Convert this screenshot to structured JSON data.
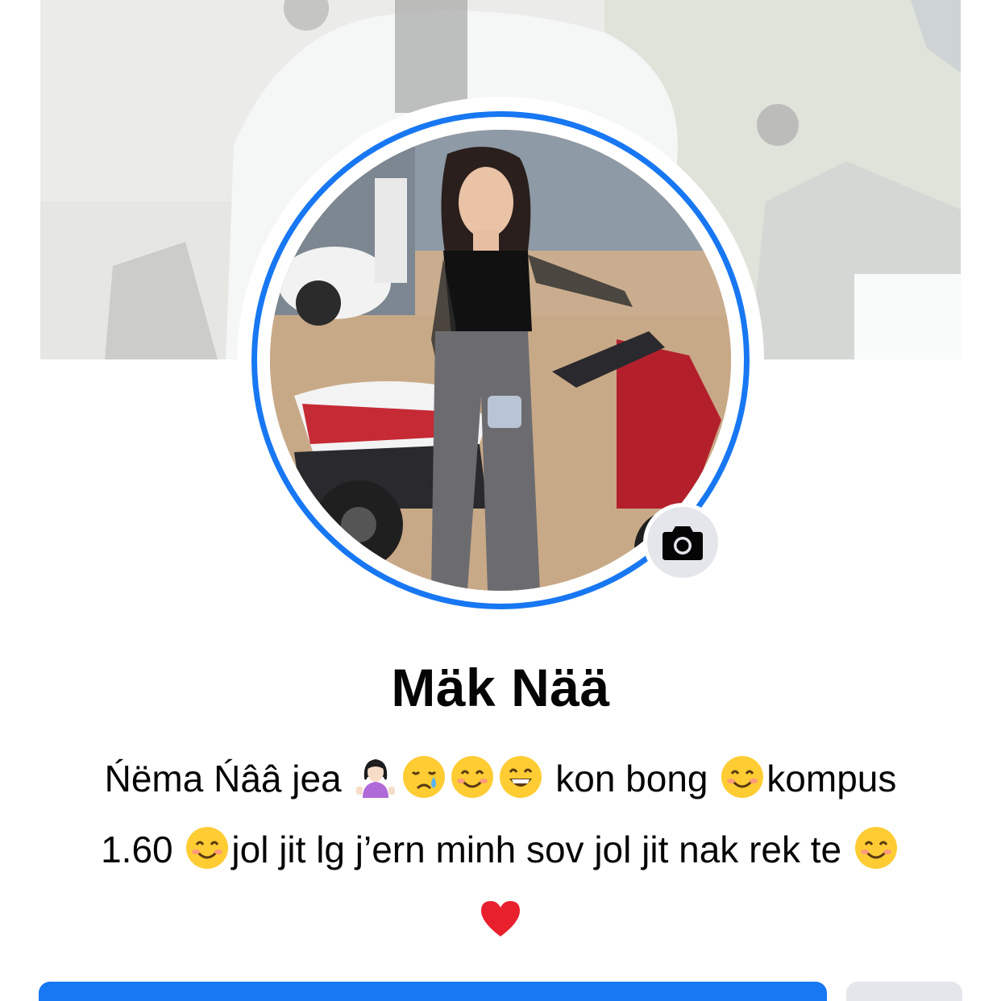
{
  "profile": {
    "name": "Mäk Nää",
    "bio_parts": [
      {
        "type": "text",
        "value": "Ńëma Ńââ jea "
      },
      {
        "type": "emoji",
        "icon": "woman-shrugging-emoji"
      },
      {
        "type": "emoji",
        "icon": "crying-face-emoji"
      },
      {
        "type": "emoji",
        "icon": "smiling-face-emoji"
      },
      {
        "type": "emoji",
        "icon": "grinning-face-emoji"
      },
      {
        "type": "text",
        "value": " kon bong "
      },
      {
        "type": "emoji",
        "icon": "smiling-face-emoji"
      },
      {
        "type": "text",
        "value": "kompus 1.60 "
      },
      {
        "type": "emoji",
        "icon": "smiling-face-emoji"
      },
      {
        "type": "text",
        "value": "jol jit lg j’ern minh sov jol jit nak rek te "
      },
      {
        "type": "emoji",
        "icon": "smiling-face-emoji"
      },
      {
        "type": "emoji",
        "icon": "red-heart-emoji"
      }
    ]
  },
  "bio_text": {
    "t1": "Ńëma Ńââ jea ",
    "t2": " kon bong ",
    "t3": "kompus",
    "t4": "1.60 ",
    "t5": "jol jit lg j’ern minh sov jol jit nak rek te "
  },
  "colors": {
    "accent": "#1877f2",
    "secondary_button": "#e4e6eb",
    "text": "#050505"
  },
  "icons": {
    "camera": "camera-icon"
  }
}
